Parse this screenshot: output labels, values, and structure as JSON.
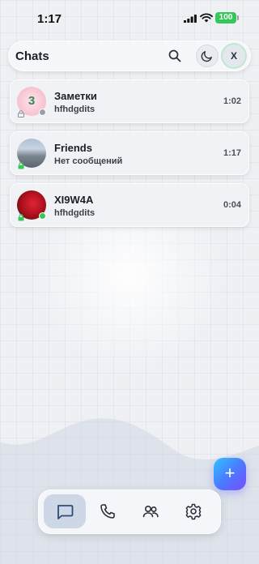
{
  "status_bar": {
    "time": "1:17",
    "battery": "100"
  },
  "header": {
    "title": "Chats",
    "search_icon": "search-icon",
    "theme_icon": "moon-icon",
    "profile_initial": "X"
  },
  "chats": [
    {
      "name": "Заметки",
      "last_message": "hfhdgdits",
      "time": "1:02",
      "avatar_text": "3",
      "online": false
    },
    {
      "name": "Friends",
      "last_message": "Нет сообщений",
      "time": "1:17",
      "avatar_text": "",
      "online": false
    },
    {
      "name": "XI9W4A",
      "last_message": "hfhdgdits",
      "time": "0:04",
      "avatar_text": "",
      "online": true
    }
  ],
  "fab": {
    "label": "+"
  },
  "nav": {
    "items": [
      {
        "icon": "chat-icon",
        "active": true
      },
      {
        "icon": "phone-icon",
        "active": false
      },
      {
        "icon": "contacts-icon",
        "active": false
      },
      {
        "icon": "settings-icon",
        "active": false
      }
    ]
  },
  "colors": {
    "accent_start": "#2ec5ff",
    "accent_end": "#7a4dff",
    "online": "#34c759",
    "offline": "#9aa0a8",
    "battery": "#34c759"
  }
}
